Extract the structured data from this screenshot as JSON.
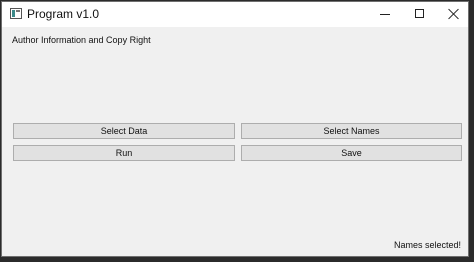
{
  "window": {
    "title": "Program v1.0"
  },
  "main": {
    "author_label": "Author Information and Copy Right",
    "buttons": {
      "select_data": "Select Data",
      "select_names": "Select Names",
      "run": "Run",
      "save": "Save"
    },
    "status": "Names selected!"
  },
  "icons": {
    "app": "app-window-icon",
    "minimize": "minimize-icon",
    "maximize": "maximize-icon",
    "close": "close-icon"
  }
}
